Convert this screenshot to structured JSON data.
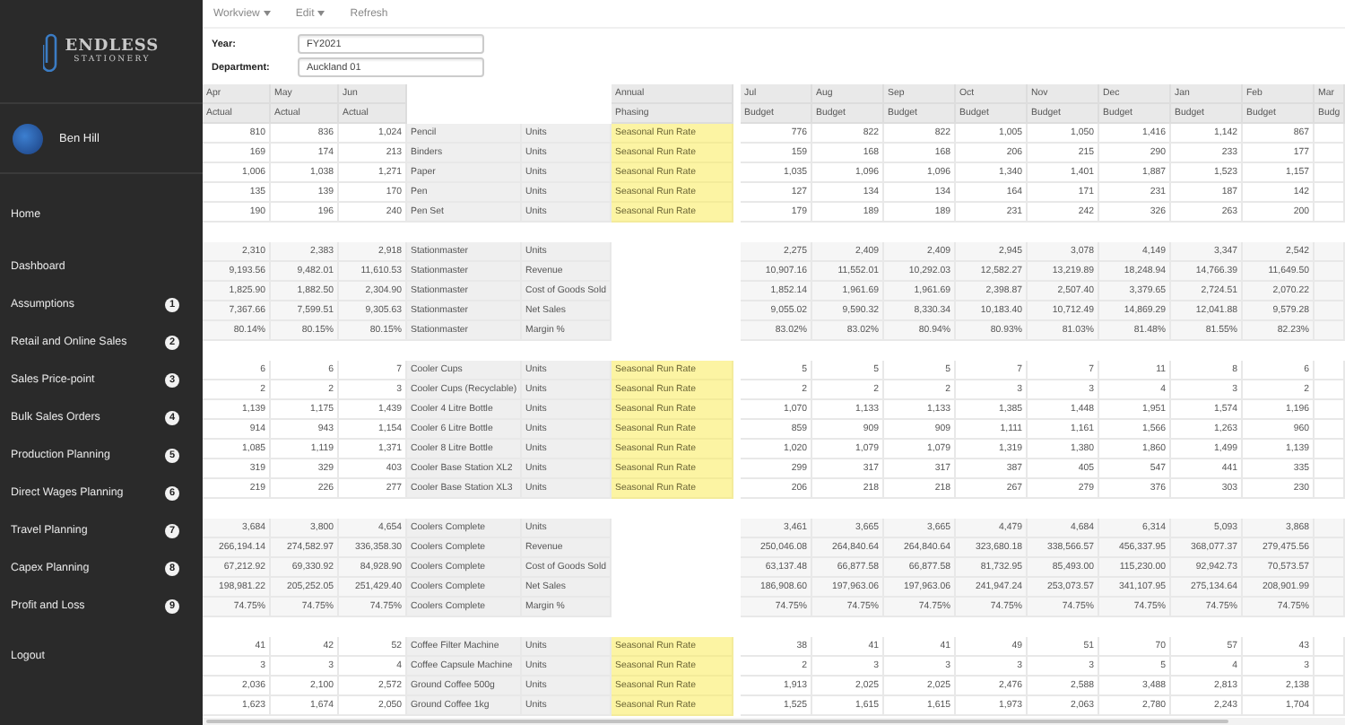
{
  "sidebar": {
    "logo": {
      "line_1": "ENDLESS",
      "line_2": "STATIONERY"
    },
    "user": {
      "name": "Ben Hill"
    },
    "items": [
      {
        "label": "Home"
      },
      {
        "label": "Dashboard"
      },
      {
        "label": "Assumptions",
        "badge": "1"
      },
      {
        "label": "Retail and Online Sales",
        "badge": "2"
      },
      {
        "label": "Sales Price-point",
        "badge": "3"
      },
      {
        "label": "Bulk Sales Orders",
        "badge": "4"
      },
      {
        "label": "Production Planning",
        "badge": "5"
      },
      {
        "label": "Direct Wages Planning",
        "badge": "6"
      },
      {
        "label": "Travel Planning",
        "badge": "7"
      },
      {
        "label": "Capex Planning",
        "badge": "8"
      },
      {
        "label": "Profit and Loss",
        "badge": "9"
      }
    ],
    "logout": "Logout"
  },
  "toolbar": [
    {
      "label": "Workview",
      "dropdown": true
    },
    {
      "label": "Edit",
      "dropdown": true
    },
    {
      "label": "Refresh",
      "dropdown": false
    }
  ],
  "filters": [
    {
      "label": "Year:",
      "value": "FY2021"
    },
    {
      "label": "Department:",
      "value": "Auckland 01"
    }
  ],
  "table": {
    "actual_columns": [
      {
        "month": "Apr",
        "type": "Actual"
      },
      {
        "month": "May",
        "type": "Actual"
      },
      {
        "month": "Jun",
        "type": "Actual"
      }
    ],
    "phasing_column": {
      "line_1": "Annual",
      "line_2": "Phasing"
    },
    "budget_columns": [
      {
        "month": "Jul",
        "type": "Budget"
      },
      {
        "month": "Aug",
        "type": "Budget"
      },
      {
        "month": "Sep",
        "type": "Budget"
      },
      {
        "month": "Oct",
        "type": "Budget"
      },
      {
        "month": "Nov",
        "type": "Budget"
      },
      {
        "month": "Dec",
        "type": "Budget"
      },
      {
        "month": "Jan",
        "type": "Budget"
      },
      {
        "month": "Feb",
        "type": "Budget"
      },
      {
        "month": "Mar",
        "type": "Budg"
      }
    ],
    "groups": [
      {
        "kind": "items",
        "rows": [
          {
            "actual": [
              "810",
              "836",
              "1,024"
            ],
            "product": "Pencil",
            "unit": "Units",
            "phasing": "Seasonal Run Rate",
            "budget": [
              "776",
              "822",
              "822",
              "1,005",
              "1,050",
              "1,416",
              "1,142",
              "867"
            ]
          },
          {
            "actual": [
              "169",
              "174",
              "213"
            ],
            "product": "Binders",
            "unit": "Units",
            "phasing": "Seasonal Run Rate",
            "budget": [
              "159",
              "168",
              "168",
              "206",
              "215",
              "290",
              "233",
              "177"
            ]
          },
          {
            "actual": [
              "1,006",
              "1,038",
              "1,271"
            ],
            "product": "Paper",
            "unit": "Units",
            "phasing": "Seasonal Run Rate",
            "budget": [
              "1,035",
              "1,096",
              "1,096",
              "1,340",
              "1,401",
              "1,887",
              "1,523",
              "1,157"
            ]
          },
          {
            "actual": [
              "135",
              "139",
              "170"
            ],
            "product": "Pen",
            "unit": "Units",
            "phasing": "Seasonal Run Rate",
            "budget": [
              "127",
              "134",
              "134",
              "164",
              "171",
              "231",
              "187",
              "142"
            ]
          },
          {
            "actual": [
              "190",
              "196",
              "240"
            ],
            "product": "Pen Set",
            "unit": "Units",
            "phasing": "Seasonal Run Rate",
            "budget": [
              "179",
              "189",
              "189",
              "231",
              "242",
              "326",
              "263",
              "200"
            ]
          }
        ]
      },
      {
        "kind": "summary",
        "rows": [
          {
            "actual": [
              "2,310",
              "2,383",
              "2,918"
            ],
            "product": "Stationmaster",
            "unit": "Units",
            "budget": [
              "2,275",
              "2,409",
              "2,409",
              "2,945",
              "3,078",
              "4,149",
              "3,347",
              "2,542"
            ]
          },
          {
            "actual": [
              "9,193.56",
              "9,482.01",
              "11,610.53"
            ],
            "product": "Stationmaster",
            "unit": "Revenue",
            "budget": [
              "10,907.16",
              "11,552.01",
              "10,292.03",
              "12,582.27",
              "13,219.89",
              "18,248.94",
              "14,766.39",
              "11,649.50"
            ]
          },
          {
            "actual": [
              "1,825.90",
              "1,882.50",
              "2,304.90"
            ],
            "product": "Stationmaster",
            "unit": "Cost of Goods Sold",
            "budget": [
              "1,852.14",
              "1,961.69",
              "1,961.69",
              "2,398.87",
              "2,507.40",
              "3,379.65",
              "2,724.51",
              "2,070.22"
            ]
          },
          {
            "actual": [
              "7,367.66",
              "7,599.51",
              "9,305.63"
            ],
            "product": "Stationmaster",
            "unit": "Net Sales",
            "budget": [
              "9,055.02",
              "9,590.32",
              "8,330.34",
              "10,183.40",
              "10,712.49",
              "14,869.29",
              "12,041.88",
              "9,579.28"
            ]
          },
          {
            "actual": [
              "80.14%",
              "80.15%",
              "80.15%"
            ],
            "product": "Stationmaster",
            "unit": "Margin %",
            "budget": [
              "83.02%",
              "83.02%",
              "80.94%",
              "80.93%",
              "81.03%",
              "81.48%",
              "81.55%",
              "82.23%"
            ]
          }
        ]
      },
      {
        "kind": "items",
        "rows": [
          {
            "actual": [
              "6",
              "6",
              "7"
            ],
            "product": "Cooler Cups",
            "unit": "Units",
            "phasing": "Seasonal Run Rate",
            "budget": [
              "5",
              "5",
              "5",
              "7",
              "7",
              "11",
              "8",
              "6"
            ]
          },
          {
            "actual": [
              "2",
              "2",
              "3"
            ],
            "product": "Cooler Cups (Recyclable)",
            "unit": "Units",
            "phasing": "Seasonal Run Rate",
            "budget": [
              "2",
              "2",
              "2",
              "3",
              "3",
              "4",
              "3",
              "2"
            ]
          },
          {
            "actual": [
              "1,139",
              "1,175",
              "1,439"
            ],
            "product": "Cooler 4 Litre Bottle",
            "unit": "Units",
            "phasing": "Seasonal Run Rate",
            "budget": [
              "1,070",
              "1,133",
              "1,133",
              "1,385",
              "1,448",
              "1,951",
              "1,574",
              "1,196"
            ]
          },
          {
            "actual": [
              "914",
              "943",
              "1,154"
            ],
            "product": "Cooler 6 Litre Bottle",
            "unit": "Units",
            "phasing": "Seasonal Run Rate",
            "budget": [
              "859",
              "909",
              "909",
              "1,111",
              "1,161",
              "1,566",
              "1,263",
              "960"
            ]
          },
          {
            "actual": [
              "1,085",
              "1,119",
              "1,371"
            ],
            "product": "Cooler 8 Litre Bottle",
            "unit": "Units",
            "phasing": "Seasonal Run Rate",
            "budget": [
              "1,020",
              "1,079",
              "1,079",
              "1,319",
              "1,380",
              "1,860",
              "1,499",
              "1,139"
            ]
          },
          {
            "actual": [
              "319",
              "329",
              "403"
            ],
            "product": "Cooler Base Station XL2",
            "unit": "Units",
            "phasing": "Seasonal Run Rate",
            "budget": [
              "299",
              "317",
              "317",
              "387",
              "405",
              "547",
              "441",
              "335"
            ]
          },
          {
            "actual": [
              "219",
              "226",
              "277"
            ],
            "product": "Cooler Base Station XL3",
            "unit": "Units",
            "phasing": "Seasonal Run Rate",
            "budget": [
              "206",
              "218",
              "218",
              "267",
              "279",
              "376",
              "303",
              "230"
            ]
          }
        ]
      },
      {
        "kind": "summary",
        "rows": [
          {
            "actual": [
              "3,684",
              "3,800",
              "4,654"
            ],
            "product": "Coolers Complete",
            "unit": "Units",
            "budget": [
              "3,461",
              "3,665",
              "3,665",
              "4,479",
              "4,684",
              "6,314",
              "5,093",
              "3,868"
            ]
          },
          {
            "actual": [
              "266,194.14",
              "274,582.97",
              "336,358.30"
            ],
            "product": "Coolers Complete",
            "unit": "Revenue",
            "budget": [
              "250,046.08",
              "264,840.64",
              "264,840.64",
              "323,680.18",
              "338,566.57",
              "456,337.95",
              "368,077.37",
              "279,475.56"
            ]
          },
          {
            "actual": [
              "67,212.92",
              "69,330.92",
              "84,928.90"
            ],
            "product": "Coolers Complete",
            "unit": "Cost of Goods Sold",
            "budget": [
              "63,137.48",
              "66,877.58",
              "66,877.58",
              "81,732.95",
              "85,493.00",
              "115,230.00",
              "92,942.73",
              "70,573.57"
            ]
          },
          {
            "actual": [
              "198,981.22",
              "205,252.05",
              "251,429.40"
            ],
            "product": "Coolers Complete",
            "unit": "Net Sales",
            "budget": [
              "186,908.60",
              "197,963.06",
              "197,963.06",
              "241,947.24",
              "253,073.57",
              "341,107.95",
              "275,134.64",
              "208,901.99"
            ]
          },
          {
            "actual": [
              "74.75%",
              "74.75%",
              "74.75%"
            ],
            "product": "Coolers Complete",
            "unit": "Margin %",
            "budget": [
              "74.75%",
              "74.75%",
              "74.75%",
              "74.75%",
              "74.75%",
              "74.75%",
              "74.75%",
              "74.75%"
            ]
          }
        ]
      },
      {
        "kind": "items",
        "rows": [
          {
            "actual": [
              "41",
              "42",
              "52"
            ],
            "product": "Coffee Filter Machine",
            "unit": "Units",
            "phasing": "Seasonal Run Rate",
            "budget": [
              "38",
              "41",
              "41",
              "49",
              "51",
              "70",
              "57",
              "43"
            ]
          },
          {
            "actual": [
              "3",
              "3",
              "4"
            ],
            "product": "Coffee Capsule Machine",
            "unit": "Units",
            "phasing": "Seasonal Run Rate",
            "budget": [
              "2",
              "3",
              "3",
              "3",
              "3",
              "5",
              "4",
              "3"
            ]
          },
          {
            "actual": [
              "2,036",
              "2,100",
              "2,572"
            ],
            "product": "Ground Coffee 500g",
            "unit": "Units",
            "phasing": "Seasonal Run Rate",
            "budget": [
              "1,913",
              "2,025",
              "2,025",
              "2,476",
              "2,588",
              "3,488",
              "2,813",
              "2,138"
            ]
          },
          {
            "actual": [
              "1,623",
              "1,674",
              "2,050"
            ],
            "product": "Ground Coffee 1kg",
            "unit": "Units",
            "phasing": "Seasonal Run Rate",
            "budget": [
              "1,525",
              "1,615",
              "1,615",
              "1,973",
              "2,063",
              "2,780",
              "2,243",
              "1,704"
            ]
          }
        ]
      }
    ]
  }
}
